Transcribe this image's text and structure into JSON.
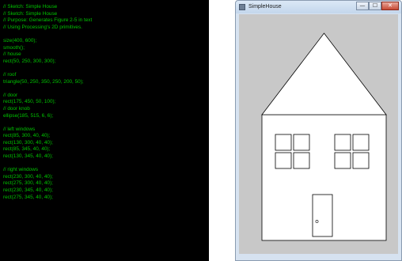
{
  "code": {
    "lines": [
      "// Sketch: Simple House",
      "// Sketch: Simple House",
      "// Purpose: Generates Figure 2-5 in text",
      "// Using Processing's 2D primitives.",
      "",
      "size(400, 600);",
      "smooth();",
      "// house",
      "rect(50, 250, 300, 300);",
      "",
      "// roof",
      "triangle(50, 250, 350, 250, 200, 50);",
      "",
      "// door",
      "rect(175, 450, 50, 100);",
      "// door knob",
      "ellipse(185, 515, 6, 6);",
      "",
      "// left windows",
      "rect(85, 300, 40, 40);",
      "rect(130, 300, 40, 40);",
      "rect(85, 345, 40, 40);",
      "rect(130, 345, 40, 40);",
      "",
      "// right windows",
      "rect(230, 300, 40, 40);",
      "rect(275, 300, 40, 40);",
      "rect(230, 345, 40, 40);",
      "rect(275, 345, 40, 40);"
    ]
  },
  "window": {
    "title": "SimpleHouse",
    "minimize_symbol": "—",
    "maximize_symbol": "☐",
    "close_symbol": "✕",
    "canvas_background": "#c8c8c8"
  },
  "colors": {
    "code_text": "#00c400",
    "code_background": "#000000"
  }
}
